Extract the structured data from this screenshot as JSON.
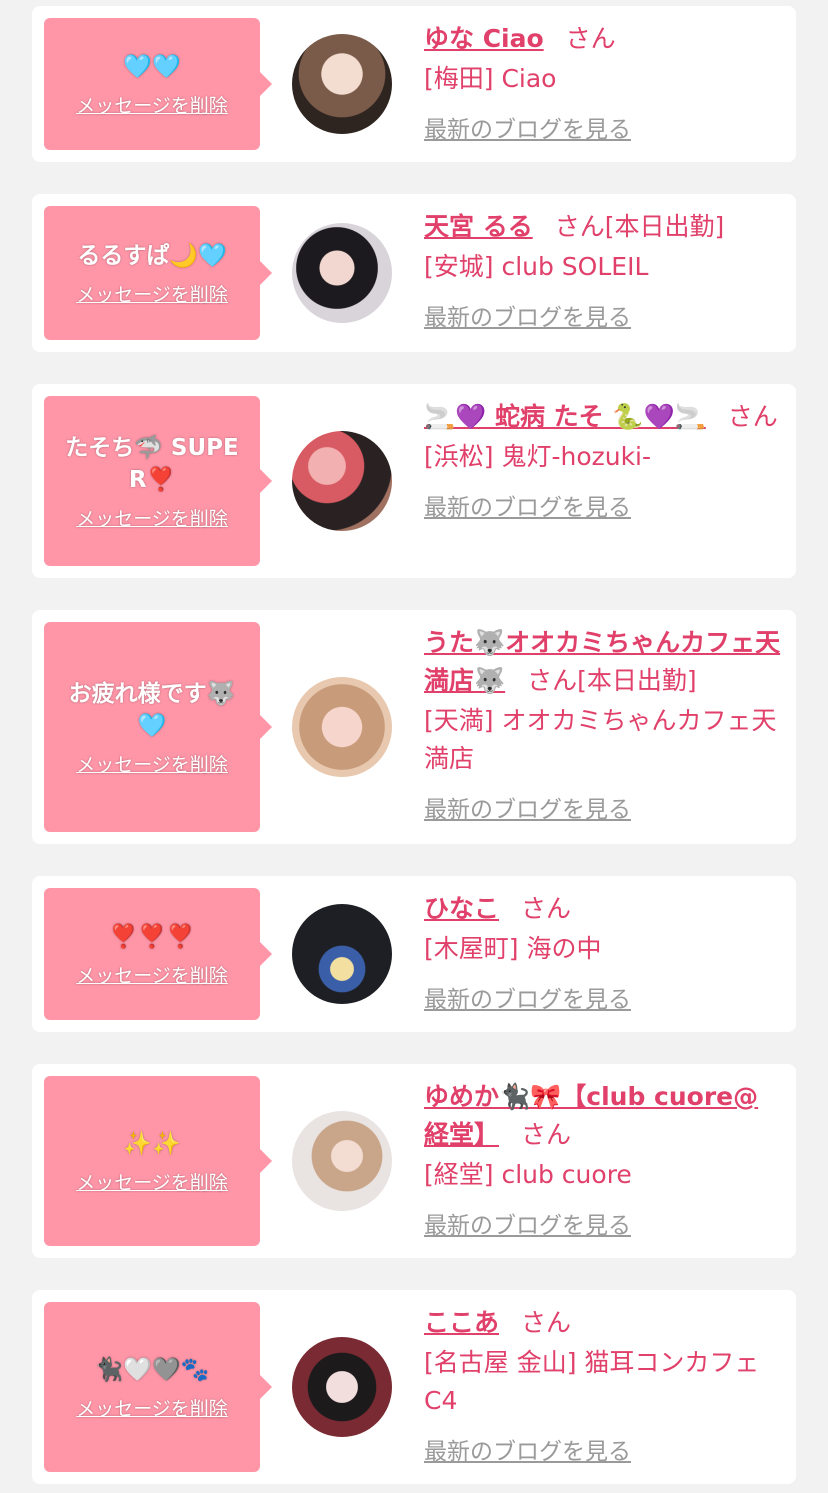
{
  "delete_label": "メッセージを削除",
  "blog_label": "最新のブログを見る",
  "san_label": "さん",
  "items": [
    {
      "message": "🩵🩵",
      "name": "ゆな Ciao",
      "tag": "",
      "shop": "[梅田] Ciao"
    },
    {
      "message": "るるすぱ🌙🩵",
      "name": "天宮 るる",
      "tag": "[本日出勤]",
      "shop": "[安城] club SOLEIL"
    },
    {
      "message": "たそち🦈 SUPER❣️",
      "name": "🚬💜 蛇病 たそ 🐍💜🚬",
      "tag": "",
      "shop": "[浜松] 鬼灯-hozuki-"
    },
    {
      "message": "お疲れ様です🐺🩵",
      "name": "うた🐺オオカミちゃんカフェ天満店🐺",
      "tag": "[本日出勤]",
      "shop": "[天満] オオカミちゃんカフェ天満店"
    },
    {
      "message": "❣️❣️❣️",
      "name": "ひなこ",
      "tag": "",
      "shop": "[木屋町] 海の中"
    },
    {
      "message": "✨✨",
      "name": "ゆめか🐈‍⬛🎀【club cuore@経堂】",
      "tag": "",
      "shop": "[経堂] club cuore"
    },
    {
      "message": "🐈‍⬛🤍🩶🐾",
      "name": "ここあ",
      "tag": "",
      "shop": "[名古屋 金山] 猫耳コンカフェC4"
    }
  ],
  "colors": {
    "background": "#f2f2f2",
    "card": "#ffffff",
    "message_box": "#ff96a8",
    "name_text": "#e0406a",
    "link_gray": "#9a9a9a"
  }
}
